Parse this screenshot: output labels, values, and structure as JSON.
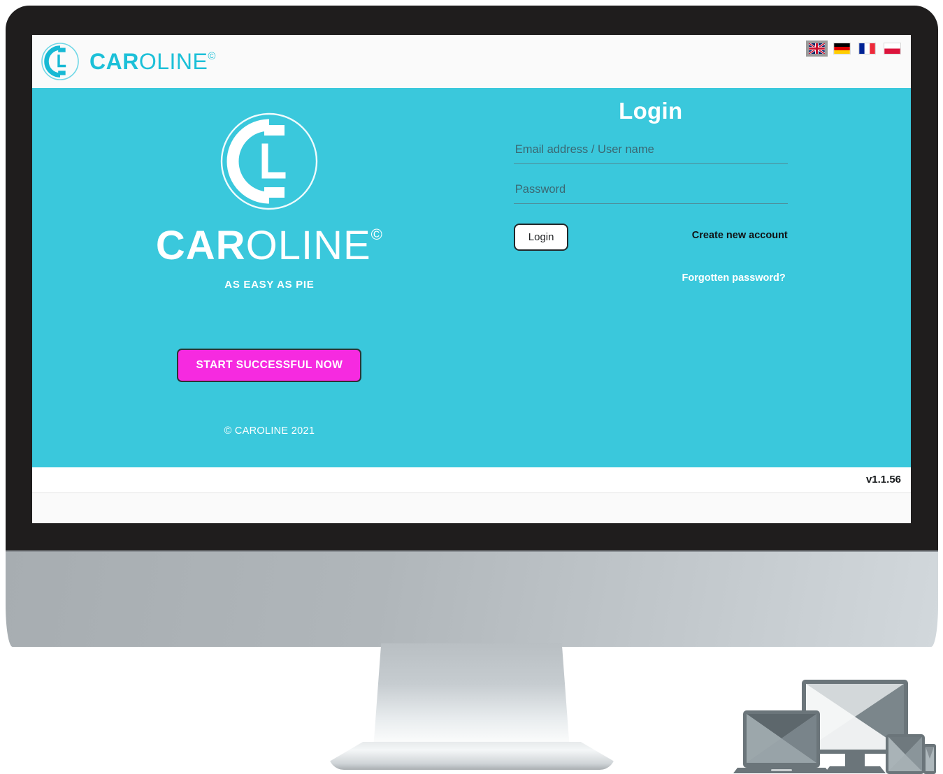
{
  "brand": {
    "name_bold": "CAR",
    "name_thin": "OLINE",
    "copyright_mark": "©",
    "logo_letter": "L",
    "accent_color": "#1cc0d8"
  },
  "header": {
    "languages": [
      {
        "code": "en",
        "name": "english-flag",
        "label": "English",
        "selected": true
      },
      {
        "code": "de",
        "name": "german-flag",
        "label": "Deutsch",
        "selected": false
      },
      {
        "code": "fr",
        "name": "french-flag",
        "label": "Français",
        "selected": false
      },
      {
        "code": "pl",
        "name": "polish-flag",
        "label": "Polski",
        "selected": false
      }
    ]
  },
  "hero": {
    "background_color": "#3ac8dc",
    "wordmark_bold": "CAR",
    "wordmark_thin": "OLINE",
    "wordmark_copyright": "©",
    "tagline": "AS EASY AS PIE",
    "cta_label": "START SUCCESSFUL NOW",
    "cta_color": "#f62ae0",
    "copyright": "© CAROLINE 2021"
  },
  "login": {
    "title": "Login",
    "username_placeholder": "Email address / User name",
    "username_value": "",
    "password_placeholder": "Password",
    "password_value": "",
    "submit_label": "Login",
    "create_account_label": "Create new account",
    "forgotten_password_label": "Forgotten password?"
  },
  "footer": {
    "version": "v1.1.56"
  }
}
